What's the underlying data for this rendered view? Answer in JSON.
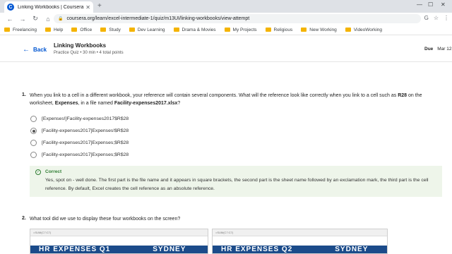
{
  "browser": {
    "tab_title": "Linking Workbooks | Coursera",
    "url": "coursera.org/learn/excel-intermediate-1/quiz/m13UI/linking-workbooks/view-attempt",
    "bookmarks": [
      "Freelancing",
      "Help",
      "Office",
      "Study",
      "Dev Learning",
      "Drama & Movies",
      "My Projects",
      "Religious",
      "New Working",
      "VideoWorking"
    ]
  },
  "header": {
    "back_label": "Back",
    "title": "Linking Workbooks",
    "meta": "Practice Quiz • 30 min • 4 total points",
    "due_label": "Due",
    "due_date": "Mar 12"
  },
  "question1": {
    "number": "1.",
    "text_a": "When you link to a cell in a different workbook, your reference will contain several components. What will the reference look like correctly when you link to a cell such as ",
    "cell": "R28",
    "text_b": " on the worksheet, ",
    "sheet": "Expenses",
    "text_c": ", in a file named ",
    "file": "Facility-expenses2017.xlsx",
    "text_d": "?",
    "options": [
      "[Expenses!]Facility-expenses2017$R$28",
      "[Facility-expenses2017]Expenses!$R$28",
      "[Facility-expenses2017]Expenses;$R$28",
      "[Facility-expenses2017]Expenses;$R$28"
    ],
    "selected_index": 1,
    "feedback": {
      "title": "Correct",
      "text": "Yes, spot on - well done. The first part is the file name and it appears in square brackets, the second part is the sheet name followed by an exclamation mark, the third part is the cell reference. By default, Excel creates the cell reference as an absolute reference."
    }
  },
  "question2": {
    "number": "2.",
    "text": "What tool did we use to display these four workbooks on the screen?",
    "thumb1_ref": "=SUM(C7:C7)",
    "thumb1_title": "HR EXPENSES Q1",
    "thumb1_city": "SYDNEY",
    "thumb2_ref": "=SUM(C7:C7)",
    "thumb2_title": "HR EXPENSES Q2",
    "thumb2_city": "SYDNEY"
  }
}
